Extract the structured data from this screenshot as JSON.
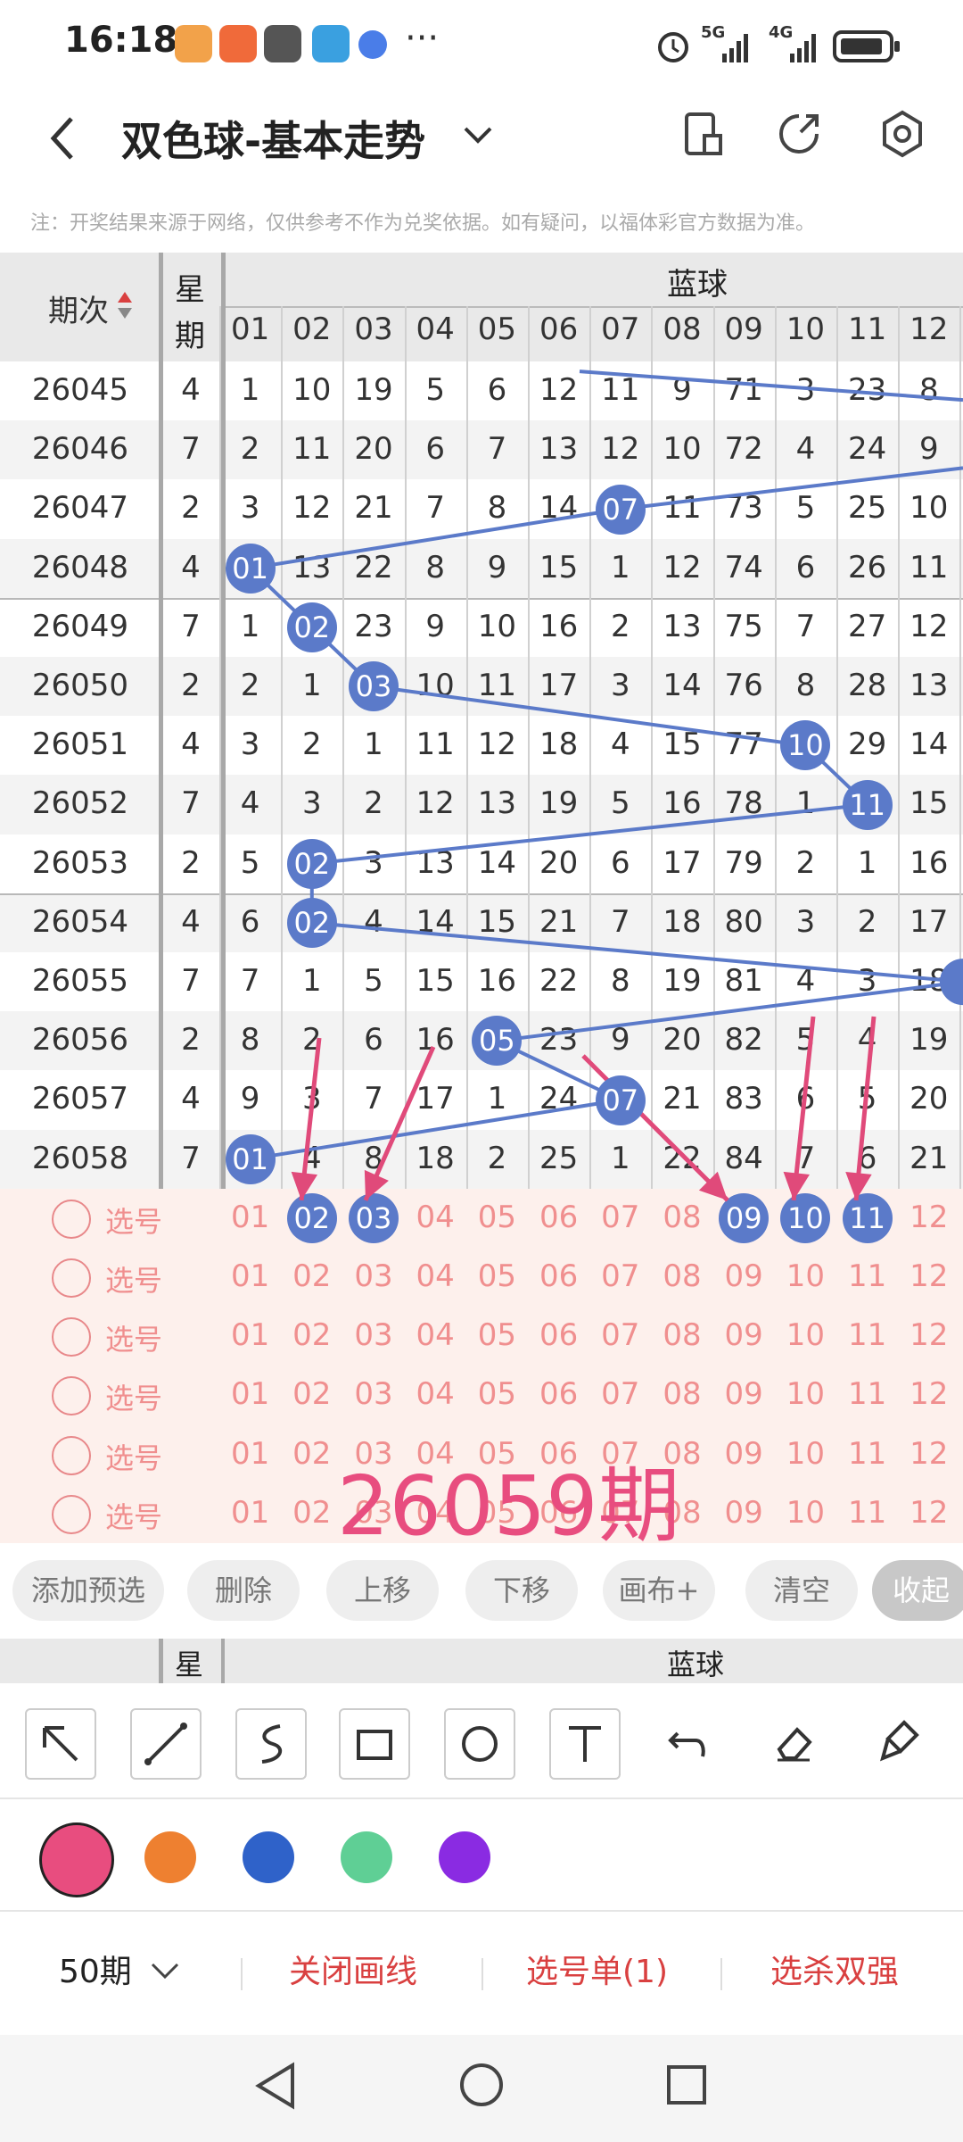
{
  "status_bar": {
    "time": "16:18",
    "more": "···",
    "network_5g": "5G",
    "network_4g": "4G"
  },
  "header": {
    "title": "双色球-基本走势"
  },
  "notice": "注：开奖结果来源于网络，仅供参考不作为兑奖依据。如有疑问，以福体彩官方数据为准。",
  "table": {
    "col_period": "期次",
    "col_week_1": "星",
    "col_week_2": "期",
    "blue_label": "蓝球",
    "blue_headers": [
      "01",
      "02",
      "03",
      "04",
      "05",
      "06",
      "07",
      "08",
      "09",
      "10",
      "11",
      "12"
    ],
    "rows": [
      {
        "period": "26045",
        "week": "4",
        "cells": [
          "1",
          "10",
          "19",
          "5",
          "6",
          "12",
          "11",
          "9",
          "71",
          "3",
          "23",
          "8"
        ]
      },
      {
        "period": "26046",
        "week": "7",
        "cells": [
          "2",
          "11",
          "20",
          "6",
          "7",
          "13",
          "12",
          "10",
          "72",
          "4",
          "24",
          "9"
        ]
      },
      {
        "period": "26047",
        "week": "2",
        "cells": [
          "3",
          "12",
          "21",
          "7",
          "8",
          "14",
          "07",
          "11",
          "73",
          "5",
          "25",
          "10"
        ]
      },
      {
        "period": "26048",
        "week": "4",
        "cells": [
          "01",
          "13",
          "22",
          "8",
          "9",
          "15",
          "1",
          "12",
          "74",
          "6",
          "26",
          "11"
        ]
      },
      {
        "period": "26049",
        "week": "7",
        "cells": [
          "1",
          "02",
          "23",
          "9",
          "10",
          "16",
          "2",
          "13",
          "75",
          "7",
          "27",
          "12"
        ]
      },
      {
        "period": "26050",
        "week": "2",
        "cells": [
          "2",
          "1",
          "03",
          "10",
          "11",
          "17",
          "3",
          "14",
          "76",
          "8",
          "28",
          "13"
        ]
      },
      {
        "period": "26051",
        "week": "4",
        "cells": [
          "3",
          "2",
          "1",
          "11",
          "12",
          "18",
          "4",
          "15",
          "77",
          "10",
          "29",
          "14"
        ]
      },
      {
        "period": "26052",
        "week": "7",
        "cells": [
          "4",
          "3",
          "2",
          "12",
          "13",
          "19",
          "5",
          "16",
          "78",
          "1",
          "11",
          "15"
        ]
      },
      {
        "period": "26053",
        "week": "2",
        "cells": [
          "5",
          "02",
          "3",
          "13",
          "14",
          "20",
          "6",
          "17",
          "79",
          "2",
          "1",
          "16"
        ]
      },
      {
        "period": "26054",
        "week": "4",
        "cells": [
          "6",
          "02",
          "4",
          "14",
          "15",
          "21",
          "7",
          "18",
          "80",
          "3",
          "2",
          "17"
        ]
      },
      {
        "period": "26055",
        "week": "7",
        "cells": [
          "7",
          "1",
          "5",
          "15",
          "16",
          "22",
          "8",
          "19",
          "81",
          "4",
          "3",
          "18"
        ]
      },
      {
        "period": "26056",
        "week": "2",
        "cells": [
          "8",
          "2",
          "6",
          "16",
          "05",
          "23",
          "9",
          "20",
          "82",
          "5",
          "4",
          "19"
        ]
      },
      {
        "period": "26057",
        "week": "4",
        "cells": [
          "9",
          "3",
          "7",
          "17",
          "1",
          "24",
          "07",
          "21",
          "83",
          "6",
          "5",
          "20"
        ]
      },
      {
        "period": "26058",
        "week": "7",
        "cells": [
          "01",
          "4",
          "8",
          "18",
          "2",
          "25",
          "1",
          "22",
          "84",
          "7",
          "6",
          "21"
        ]
      }
    ],
    "select_label": "选号",
    "select_rows": 6,
    "selected_balls": [
      "02",
      "03",
      "09",
      "10",
      "11"
    ],
    "overlay_text": "26059期"
  },
  "actions": [
    "添加预选",
    "删除",
    "上移",
    "下移",
    "画布+",
    "清空",
    "收起"
  ],
  "subheader": {
    "week": "星",
    "blue_label": "蓝球"
  },
  "tools": [
    "arrow-icon",
    "line-icon",
    "curve-icon",
    "rectangle-icon",
    "circle-icon",
    "text-icon",
    "undo-icon",
    "eraser-icon",
    "clear-brush-icon"
  ],
  "colors": [
    "#e84d7f",
    "#ee8030",
    "#2f62c9",
    "#5fcf95",
    "#8a2be2"
  ],
  "footer": {
    "periods": "50期",
    "close_draw": "关闭画线",
    "pick_list": "选号单(1)",
    "kill_strong": "选杀双强"
  },
  "accent": "#d94040",
  "ball_color": "#5b7ac9",
  "arrow_color": "#e04a7a"
}
